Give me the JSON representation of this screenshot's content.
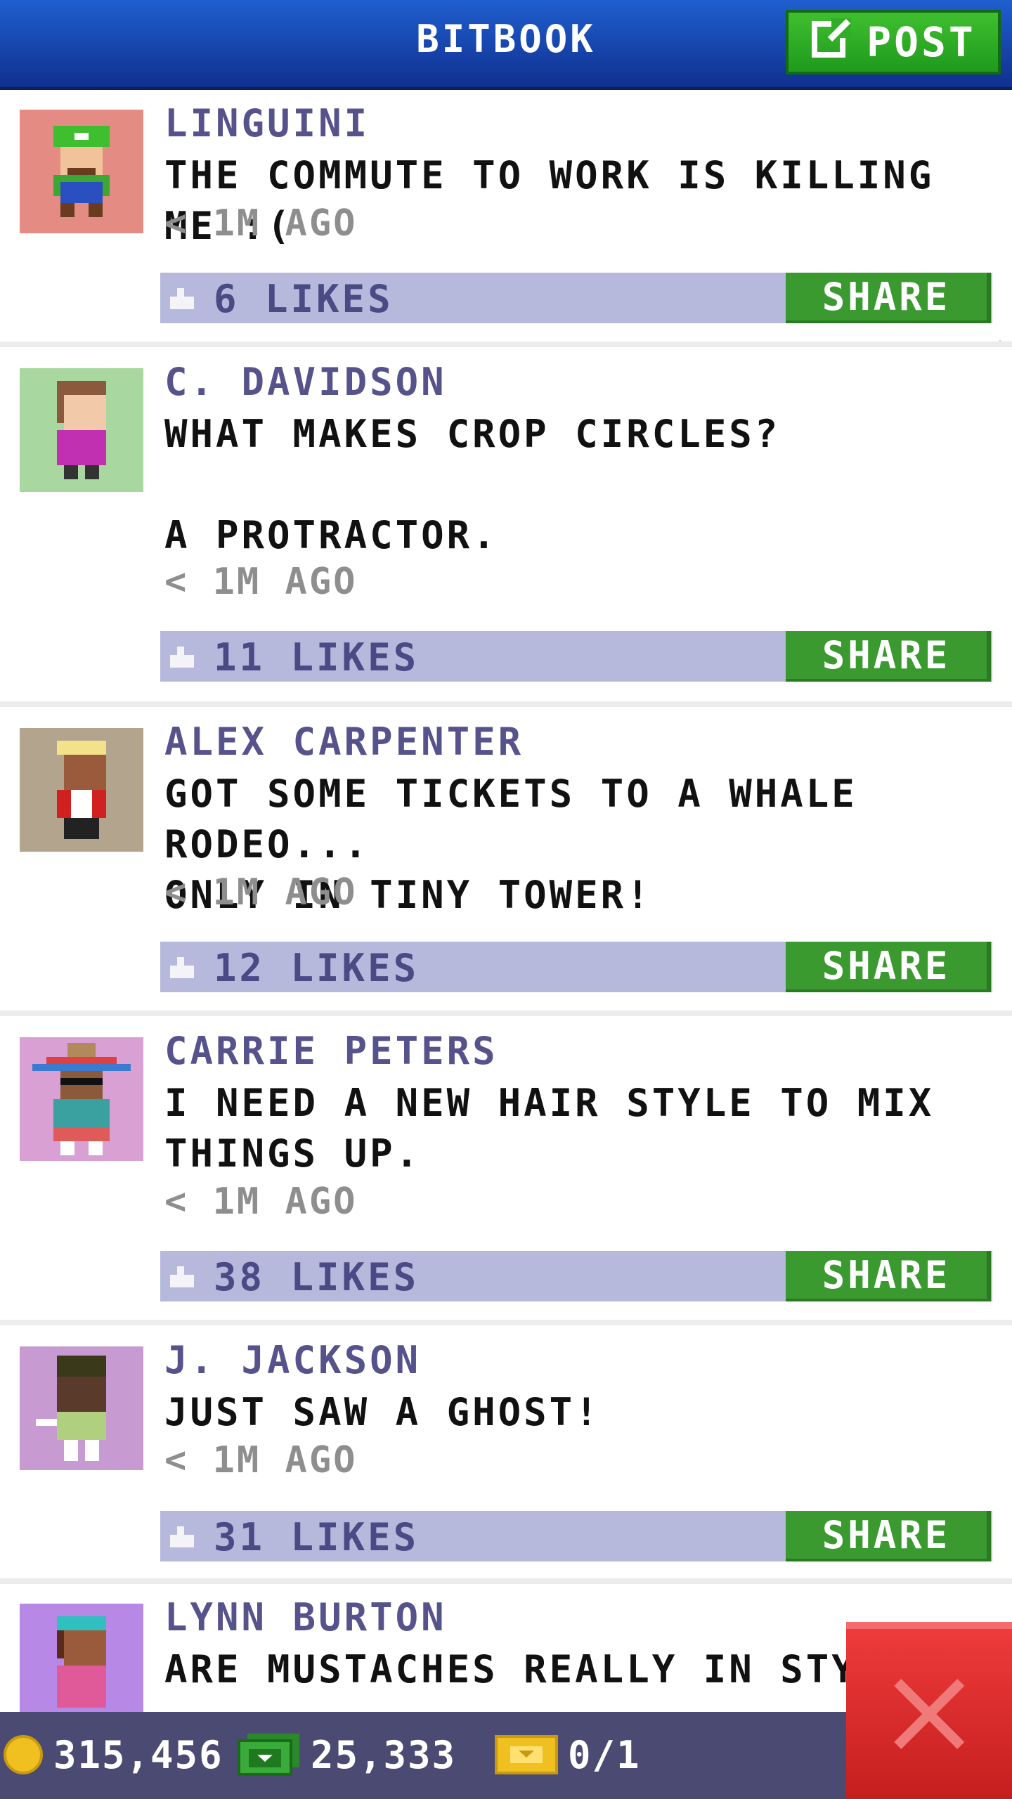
{
  "header": {
    "title": "BITBOOK",
    "post_label": "POST"
  },
  "posts": [
    {
      "author": "LINGUINI",
      "message": "THE COMMUTE TO WORK IS KILLING ME :(",
      "time": "< 1M AGO",
      "likes": "6 LIKES",
      "share": "SHARE",
      "avatar_bg": "#e48c84"
    },
    {
      "author": "C. DAVIDSON",
      "message": "WHAT MAKES CROP CIRCLES?\n\nA PROTRACTOR.",
      "time": "< 1M AGO",
      "likes": "11 LIKES",
      "share": "SHARE",
      "avatar_bg": "#a9d7a0"
    },
    {
      "author": "ALEX CARPENTER",
      "message": "GOT SOME TICKETS TO A WHALE RODEO...\nONLY IN TINY TOWER!",
      "time": "< 1M AGO",
      "likes": "12 LIKES",
      "share": "SHARE",
      "avatar_bg": "#b3a48e"
    },
    {
      "author": "CARRIE PETERS",
      "message": "I NEED A NEW HAIR STYLE TO MIX\nTHINGS UP.",
      "time": "< 1M AGO",
      "likes": "38 LIKES",
      "share": "SHARE",
      "avatar_bg": "#d9a0d3"
    },
    {
      "author": "J. JACKSON",
      "message": "JUST SAW A GHOST!",
      "time": "< 1M AGO",
      "likes": "31 LIKES",
      "share": "SHARE",
      "avatar_bg": "#c79ad1"
    },
    {
      "author": "LYNN BURTON",
      "message": "ARE MUSTACHES REALLY IN STY",
      "time": "",
      "likes": "",
      "share": "",
      "avatar_bg": "#b888e6"
    }
  ],
  "footer": {
    "coins": "315,456",
    "bux": "25,333",
    "tickets": "0/1"
  },
  "colors": {
    "header": "#1a4fbf",
    "post_button": "#2fae27",
    "like_bar": "#b6b8dc",
    "share_button": "#3a9a30",
    "author_text": "#56538c",
    "close_button": "#d82828"
  },
  "icons": {
    "post": "edit-icon",
    "like": "thumbs-up-icon",
    "coin": "coin-icon",
    "bux": "bux-icon",
    "ticket": "ticket-icon",
    "close": "close-icon"
  }
}
